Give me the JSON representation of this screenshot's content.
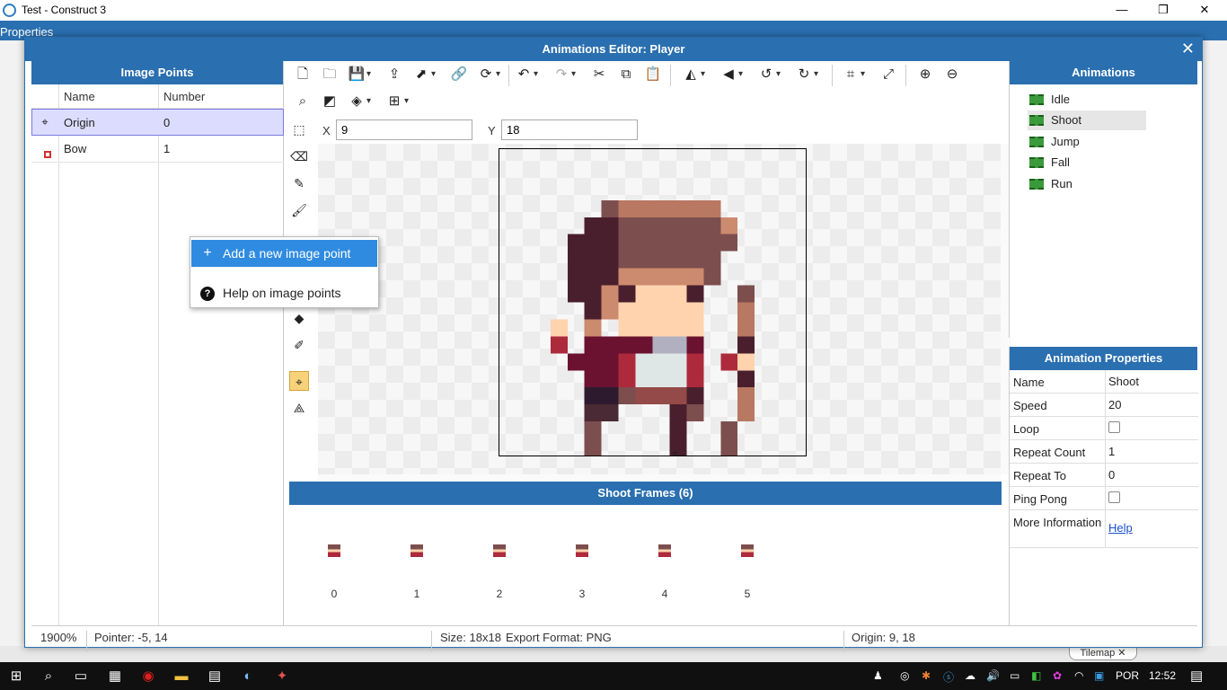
{
  "window": {
    "title": "Test - Construct 3",
    "min": "—",
    "max": "❐",
    "close": "✕"
  },
  "background": {
    "properties_label": "Properties",
    "tilemap_tab": "Tilemap ✕"
  },
  "dialog": {
    "title": "Animations Editor: Player",
    "close": "✕"
  },
  "image_points": {
    "heading": "Image Points",
    "columns": [
      "Name",
      "Number"
    ],
    "rows": [
      {
        "name": "Origin",
        "number": "0",
        "icon": "origin-crosshair-icon"
      },
      {
        "name": "Bow",
        "number": "1",
        "icon": "point-square-icon"
      }
    ]
  },
  "context_menu": {
    "items": [
      {
        "label": "Add a new image point",
        "icon": "+"
      },
      {
        "label": "Help on image points",
        "icon": "?"
      }
    ]
  },
  "coords": {
    "x_label": "X",
    "x_value": "9",
    "y_label": "Y",
    "y_value": "18"
  },
  "frames": {
    "heading": "Shoot Frames (6)",
    "numbers": [
      "0",
      "1",
      "2",
      "3",
      "4",
      "5"
    ]
  },
  "animations": {
    "heading": "Animations",
    "items": [
      "Idle",
      "Shoot",
      "Jump",
      "Fall",
      "Run"
    ],
    "selected": "Shoot"
  },
  "animation_properties": {
    "heading": "Animation Properties",
    "name_label": "Name",
    "name_value": "Shoot",
    "speed_label": "Speed",
    "speed_value": "20",
    "loop_label": "Loop",
    "repeat_count_label": "Repeat Count",
    "repeat_count_value": "1",
    "repeat_to_label": "Repeat To",
    "repeat_to_value": "0",
    "ping_pong_label": "Ping Pong",
    "more_info_label": "More Information",
    "more_info_link": "Help"
  },
  "status": {
    "zoom": "1900%",
    "pointer": "Pointer: -5, 14",
    "size": "Size: 18x18",
    "export": "Export Format: PNG",
    "origin": "Origin: 9, 18"
  },
  "taskbar": {
    "lang": "POR",
    "time": "12:52"
  },
  "colors": {
    "accent": "#2a6fb0",
    "highlight": "#2f8be0",
    "selected_row": "#dcdcff",
    "active_tool": "#f7d27a"
  }
}
